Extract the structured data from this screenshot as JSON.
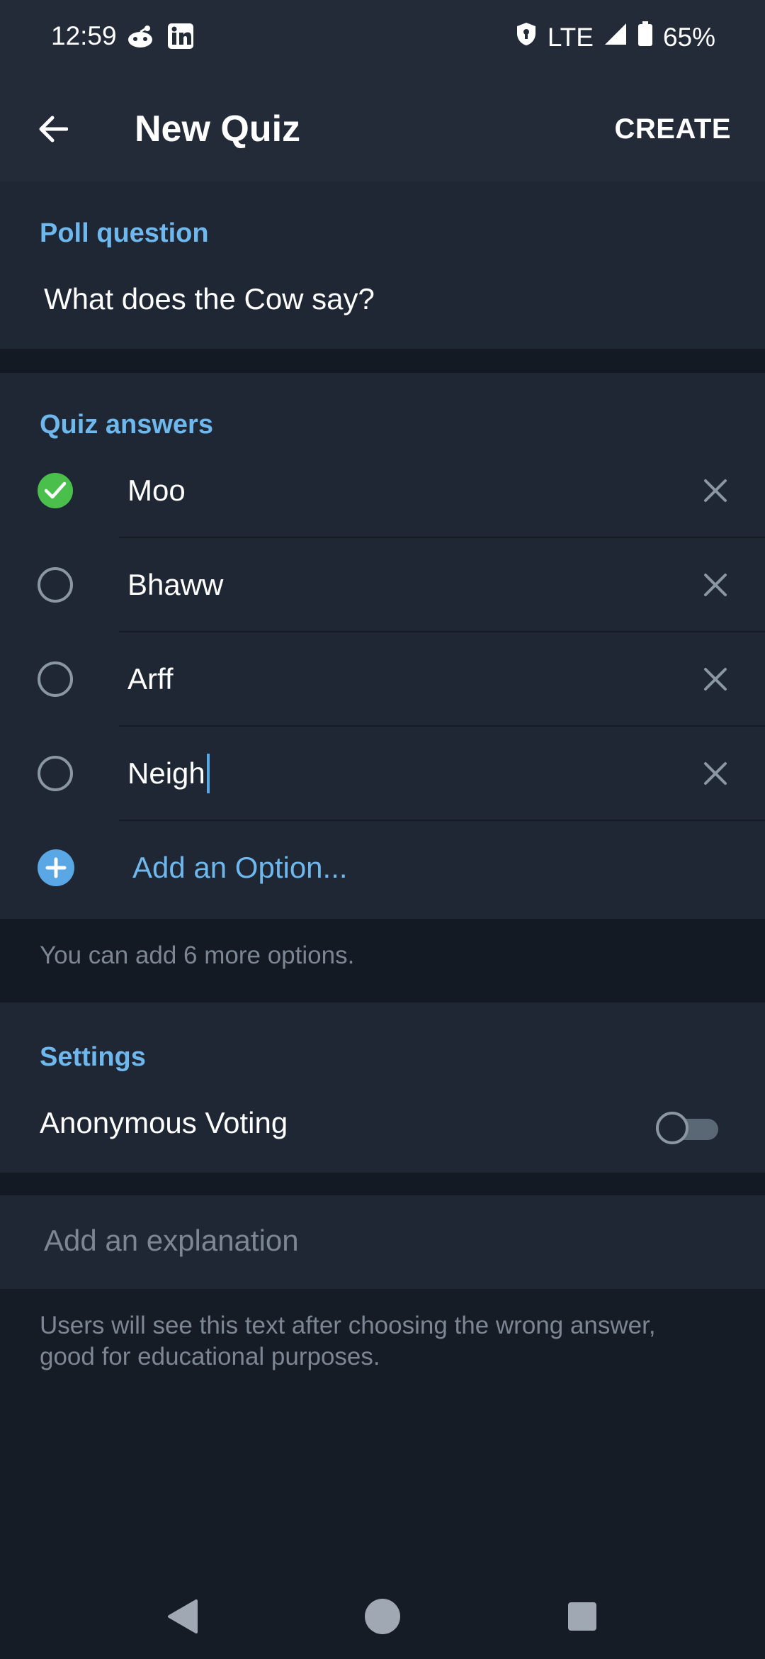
{
  "status_bar": {
    "time": "12:59",
    "network": "LTE",
    "battery": "65%",
    "icons": [
      "reddit-icon",
      "linkedin-icon",
      "vpn-shield-icon",
      "signal-icon",
      "battery-icon"
    ]
  },
  "app_bar": {
    "title": "New Quiz",
    "create_label": "CREATE"
  },
  "question": {
    "header": "Poll question",
    "value": "What does the Cow say?"
  },
  "answers": {
    "header": "Quiz answers",
    "items": [
      {
        "text": "Moo",
        "correct": true
      },
      {
        "text": "Bhaww",
        "correct": false
      },
      {
        "text": "Arff",
        "correct": false
      },
      {
        "text": "Neigh",
        "correct": false
      }
    ],
    "add_option_label": "Add an Option...",
    "hint": "You can add 6 more options."
  },
  "settings": {
    "header": "Settings",
    "anonymous_voting_label": "Anonymous Voting",
    "anonymous_voting_on": false
  },
  "explanation": {
    "placeholder": "Add an explanation",
    "hint_line1": "Users will see this text after choosing the wrong answer,",
    "hint_line2": "good for educational purposes."
  },
  "colors": {
    "accent": "#6fb8ee",
    "correct": "#4bbf4b",
    "surface": "#1e2733",
    "background": "#161c26"
  }
}
